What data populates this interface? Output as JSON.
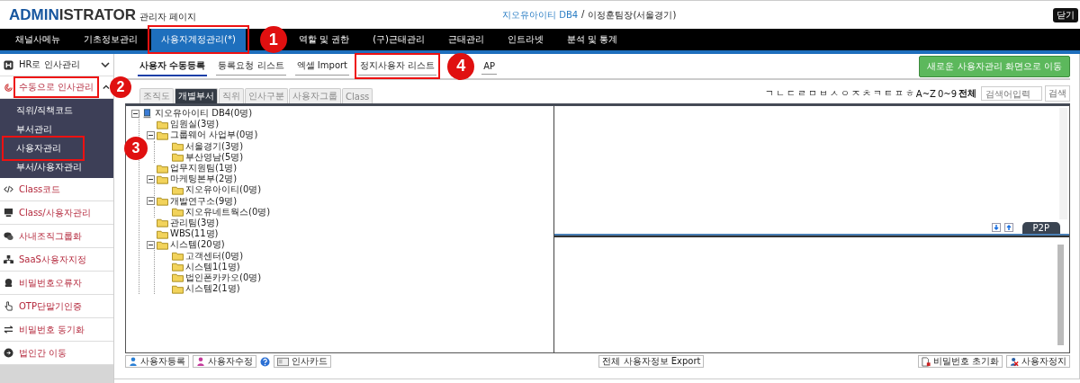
{
  "header": {
    "logo": {
      "accent": "ADMIN",
      "rest": "ISTRATOR"
    },
    "subtitle": "관리자 페이지",
    "company": "지오유아이티 DB4",
    "separator": "/",
    "user": "이정훈팀장(서울경기)",
    "close": "닫기"
  },
  "nav": [
    {
      "label": "채널사메뉴",
      "selected": false
    },
    {
      "label": "기초정보관리",
      "selected": false
    },
    {
      "label": "사용자계정관리(*)",
      "selected": true,
      "callout": "1"
    },
    {
      "label": "역할 및 권한",
      "selected": false
    },
    {
      "label": "(구)근태관리",
      "selected": false
    },
    {
      "label": "근태관리",
      "selected": false
    },
    {
      "label": "인트라넷",
      "selected": false
    },
    {
      "label": "분석 및 통계",
      "selected": false
    }
  ],
  "sidebar": {
    "items": [
      {
        "label": "HR로 인사관리",
        "kind": "section",
        "expanded": false
      },
      {
        "label": "수동으로 인사관리",
        "kind": "section-active",
        "expanded": true,
        "callout": "2",
        "children": [
          {
            "label": "직위/직책코드"
          },
          {
            "label": "부서관리"
          },
          {
            "label": "사용자관리",
            "callout": "3"
          },
          {
            "label": "부서/사용자관리"
          }
        ]
      },
      {
        "label": "Class코드",
        "kind": "menu"
      },
      {
        "label": "Class/사용자관리",
        "kind": "menu"
      },
      {
        "label": "사내조직그룹화",
        "kind": "menu"
      },
      {
        "label": "SaaS사용자지정",
        "kind": "menu"
      },
      {
        "label": "비밀번호오류자",
        "kind": "menu"
      },
      {
        "label": "OTP단말기인증",
        "kind": "menu"
      },
      {
        "label": "비밀번호 동기화",
        "kind": "menu"
      },
      {
        "label": "법인간 이동",
        "kind": "menu"
      }
    ]
  },
  "subtabs": [
    {
      "label": "사용자 수동등록",
      "selected": true
    },
    {
      "label": "등록요청 리스트",
      "selected": false
    },
    {
      "label": "엑셀 Import",
      "selected": false
    },
    {
      "label": "정지사용자 리스트",
      "selected": false,
      "callout": "4"
    },
    {
      "label": "AP",
      "selected": false
    }
  ],
  "new_screen_button": "새로운 사용자관리 화면으로 이동",
  "view_tabs": [
    {
      "label": "조직도",
      "selected": false
    },
    {
      "label": "개별부서",
      "selected": true
    },
    {
      "label": "직위",
      "selected": false
    },
    {
      "label": "인사구분",
      "selected": false
    },
    {
      "label": "사용자그룹",
      "selected": false
    },
    {
      "label": "Class",
      "selected": false
    }
  ],
  "index": {
    "letters": [
      "ㄱ",
      "ㄴ",
      "ㄷ",
      "ㄹ",
      "ㅁ",
      "ㅂ",
      "ㅅ",
      "ㅇ",
      "ㅈ",
      "ㅊ",
      "ㅋ",
      "ㅌ",
      "ㅍ",
      "ㅎ",
      "A~Z",
      "0~9"
    ],
    "all": "전체"
  },
  "search": {
    "placeholder": "검색어입력",
    "button": "검색"
  },
  "tree": {
    "label": "지오유아이티 DB4(0명)",
    "kind": "server",
    "expanded": true,
    "children": [
      {
        "label": "임원실(3명)",
        "kind": "folder"
      },
      {
        "label": "그룹웨어 사업부(0명)",
        "kind": "folder",
        "expanded": true,
        "children": [
          {
            "label": "서울경기(3명)",
            "kind": "folder"
          },
          {
            "label": "부산영남(5명)",
            "kind": "folder"
          }
        ]
      },
      {
        "label": "업무지원팀(1명)",
        "kind": "folder"
      },
      {
        "label": "마케팅본부(2명)",
        "kind": "folder",
        "expanded": true,
        "children": [
          {
            "label": "지오유아이티(0명)",
            "kind": "folder"
          }
        ]
      },
      {
        "label": "개발연구소(9명)",
        "kind": "folder",
        "expanded": true,
        "children": [
          {
            "label": "지오유네트웍스(0명)",
            "kind": "folder"
          }
        ]
      },
      {
        "label": "관리팀(3명)",
        "kind": "folder"
      },
      {
        "label": "WBS(11명)",
        "kind": "folder"
      },
      {
        "label": "시스템(20명)",
        "kind": "folder",
        "expanded": true,
        "children": [
          {
            "label": "고객센터(0명)",
            "kind": "folder"
          },
          {
            "label": "시스템1(1명)",
            "kind": "folder"
          },
          {
            "label": "법인폰카카오(0명)",
            "kind": "folder"
          },
          {
            "label": "시스템2(1명)",
            "kind": "folder"
          }
        ]
      }
    ]
  },
  "p2p_tab": "P2P",
  "bottom_left": [
    {
      "label": "사용자등록",
      "kind": "user-blue"
    },
    {
      "label": "사용자수정",
      "kind": "user-pink"
    },
    {
      "kind": "help"
    },
    {
      "label": "인사카드",
      "kind": "card"
    }
  ],
  "export_button": "전체 사용자정보 Export",
  "bottom_right": [
    {
      "label": "비밀번호 초기화",
      "kind": "doc"
    },
    {
      "label": "사용자정지",
      "kind": "user-stop"
    }
  ]
}
